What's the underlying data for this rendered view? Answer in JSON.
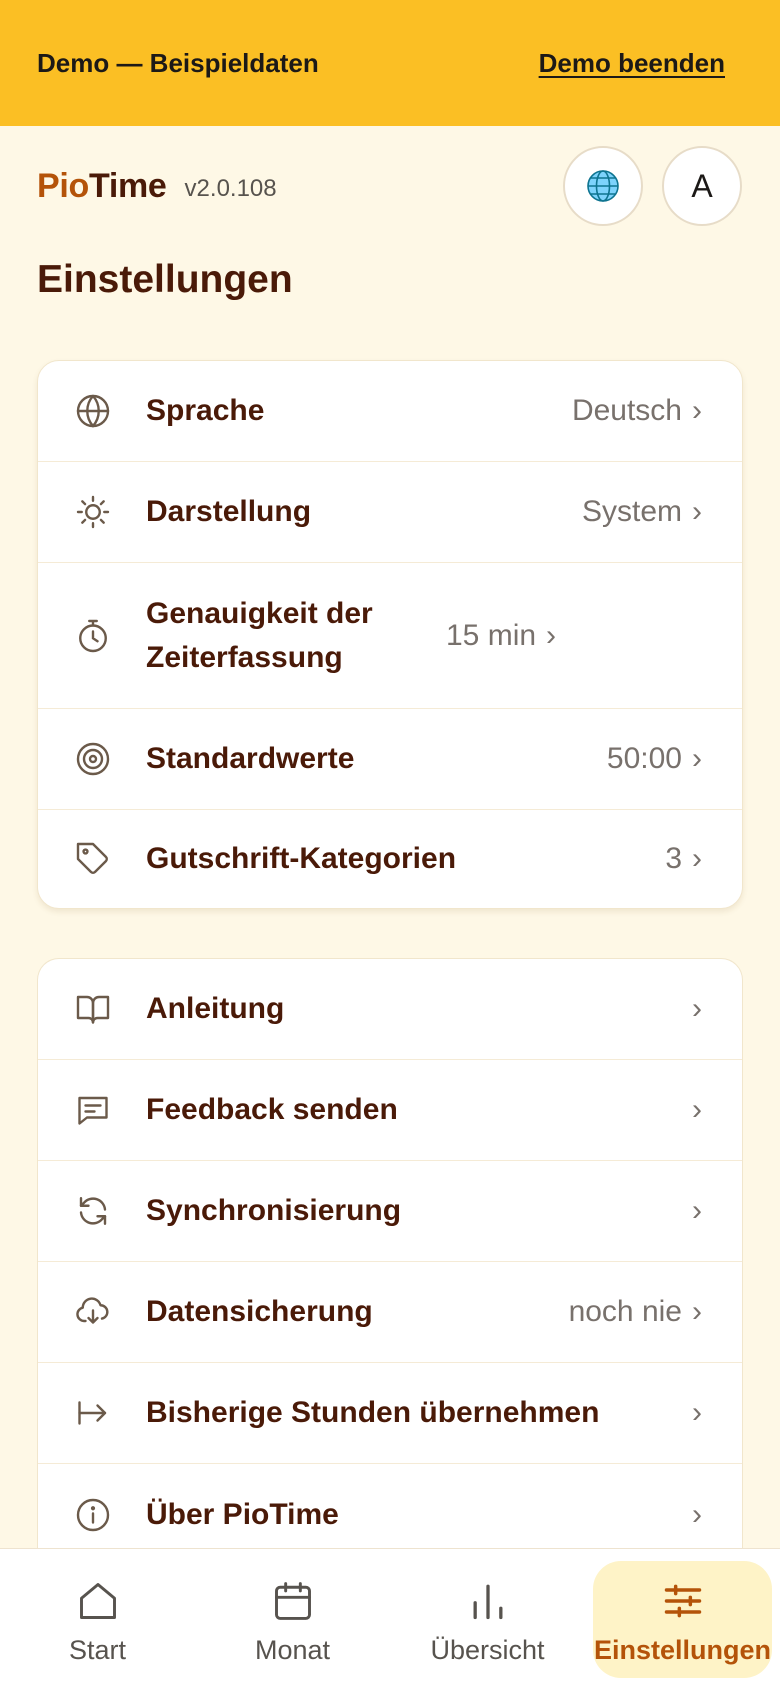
{
  "banner": {
    "text": "Demo — Beispieldaten",
    "action": "Demo beenden"
  },
  "header": {
    "brand_part1": "Pio",
    "brand_part2": "Time",
    "version": "v2.0.108",
    "avatar_letter": "A"
  },
  "page_title": "Einstellungen",
  "settings": [
    {
      "label": "Sprache",
      "value": "Deutsch",
      "icon": "globe-icon"
    },
    {
      "label": "Darstellung",
      "value": "System",
      "icon": "sun-icon"
    },
    {
      "label": "Genauigkeit der Zeiterfassung",
      "value": "15 min",
      "icon": "timer-icon"
    },
    {
      "label": "Standardwerte",
      "value": "50:00",
      "icon": "target-icon"
    },
    {
      "label": "Gutschrift-Kategorien",
      "value": "3",
      "icon": "tag-icon"
    }
  ],
  "more": [
    {
      "label": "Anleitung",
      "value": "",
      "icon": "book-icon"
    },
    {
      "label": "Feedback senden",
      "value": "",
      "icon": "message-icon"
    },
    {
      "label": "Synchronisierung",
      "value": "",
      "icon": "sync-icon"
    },
    {
      "label": "Datensicherung",
      "value": "noch nie",
      "icon": "cloud-download-icon"
    },
    {
      "label": "Bisherige Stunden übernehmen",
      "value": "",
      "icon": "import-arrow-icon"
    },
    {
      "label": "Über PioTime",
      "value": "",
      "icon": "info-icon"
    }
  ],
  "chevron": "›",
  "nav": [
    {
      "label": "Start",
      "icon": "home-icon",
      "active": false
    },
    {
      "label": "Monat",
      "icon": "calendar-icon",
      "active": false
    },
    {
      "label": "Übersicht",
      "icon": "bar-chart-icon",
      "active": false
    },
    {
      "label": "Einstellungen",
      "icon": "sliders-icon",
      "active": true
    }
  ],
  "colors": {
    "banner": "#FBBF24",
    "background": "#FEF8E6",
    "accent": "#B45309",
    "text": "#4A1A08"
  }
}
